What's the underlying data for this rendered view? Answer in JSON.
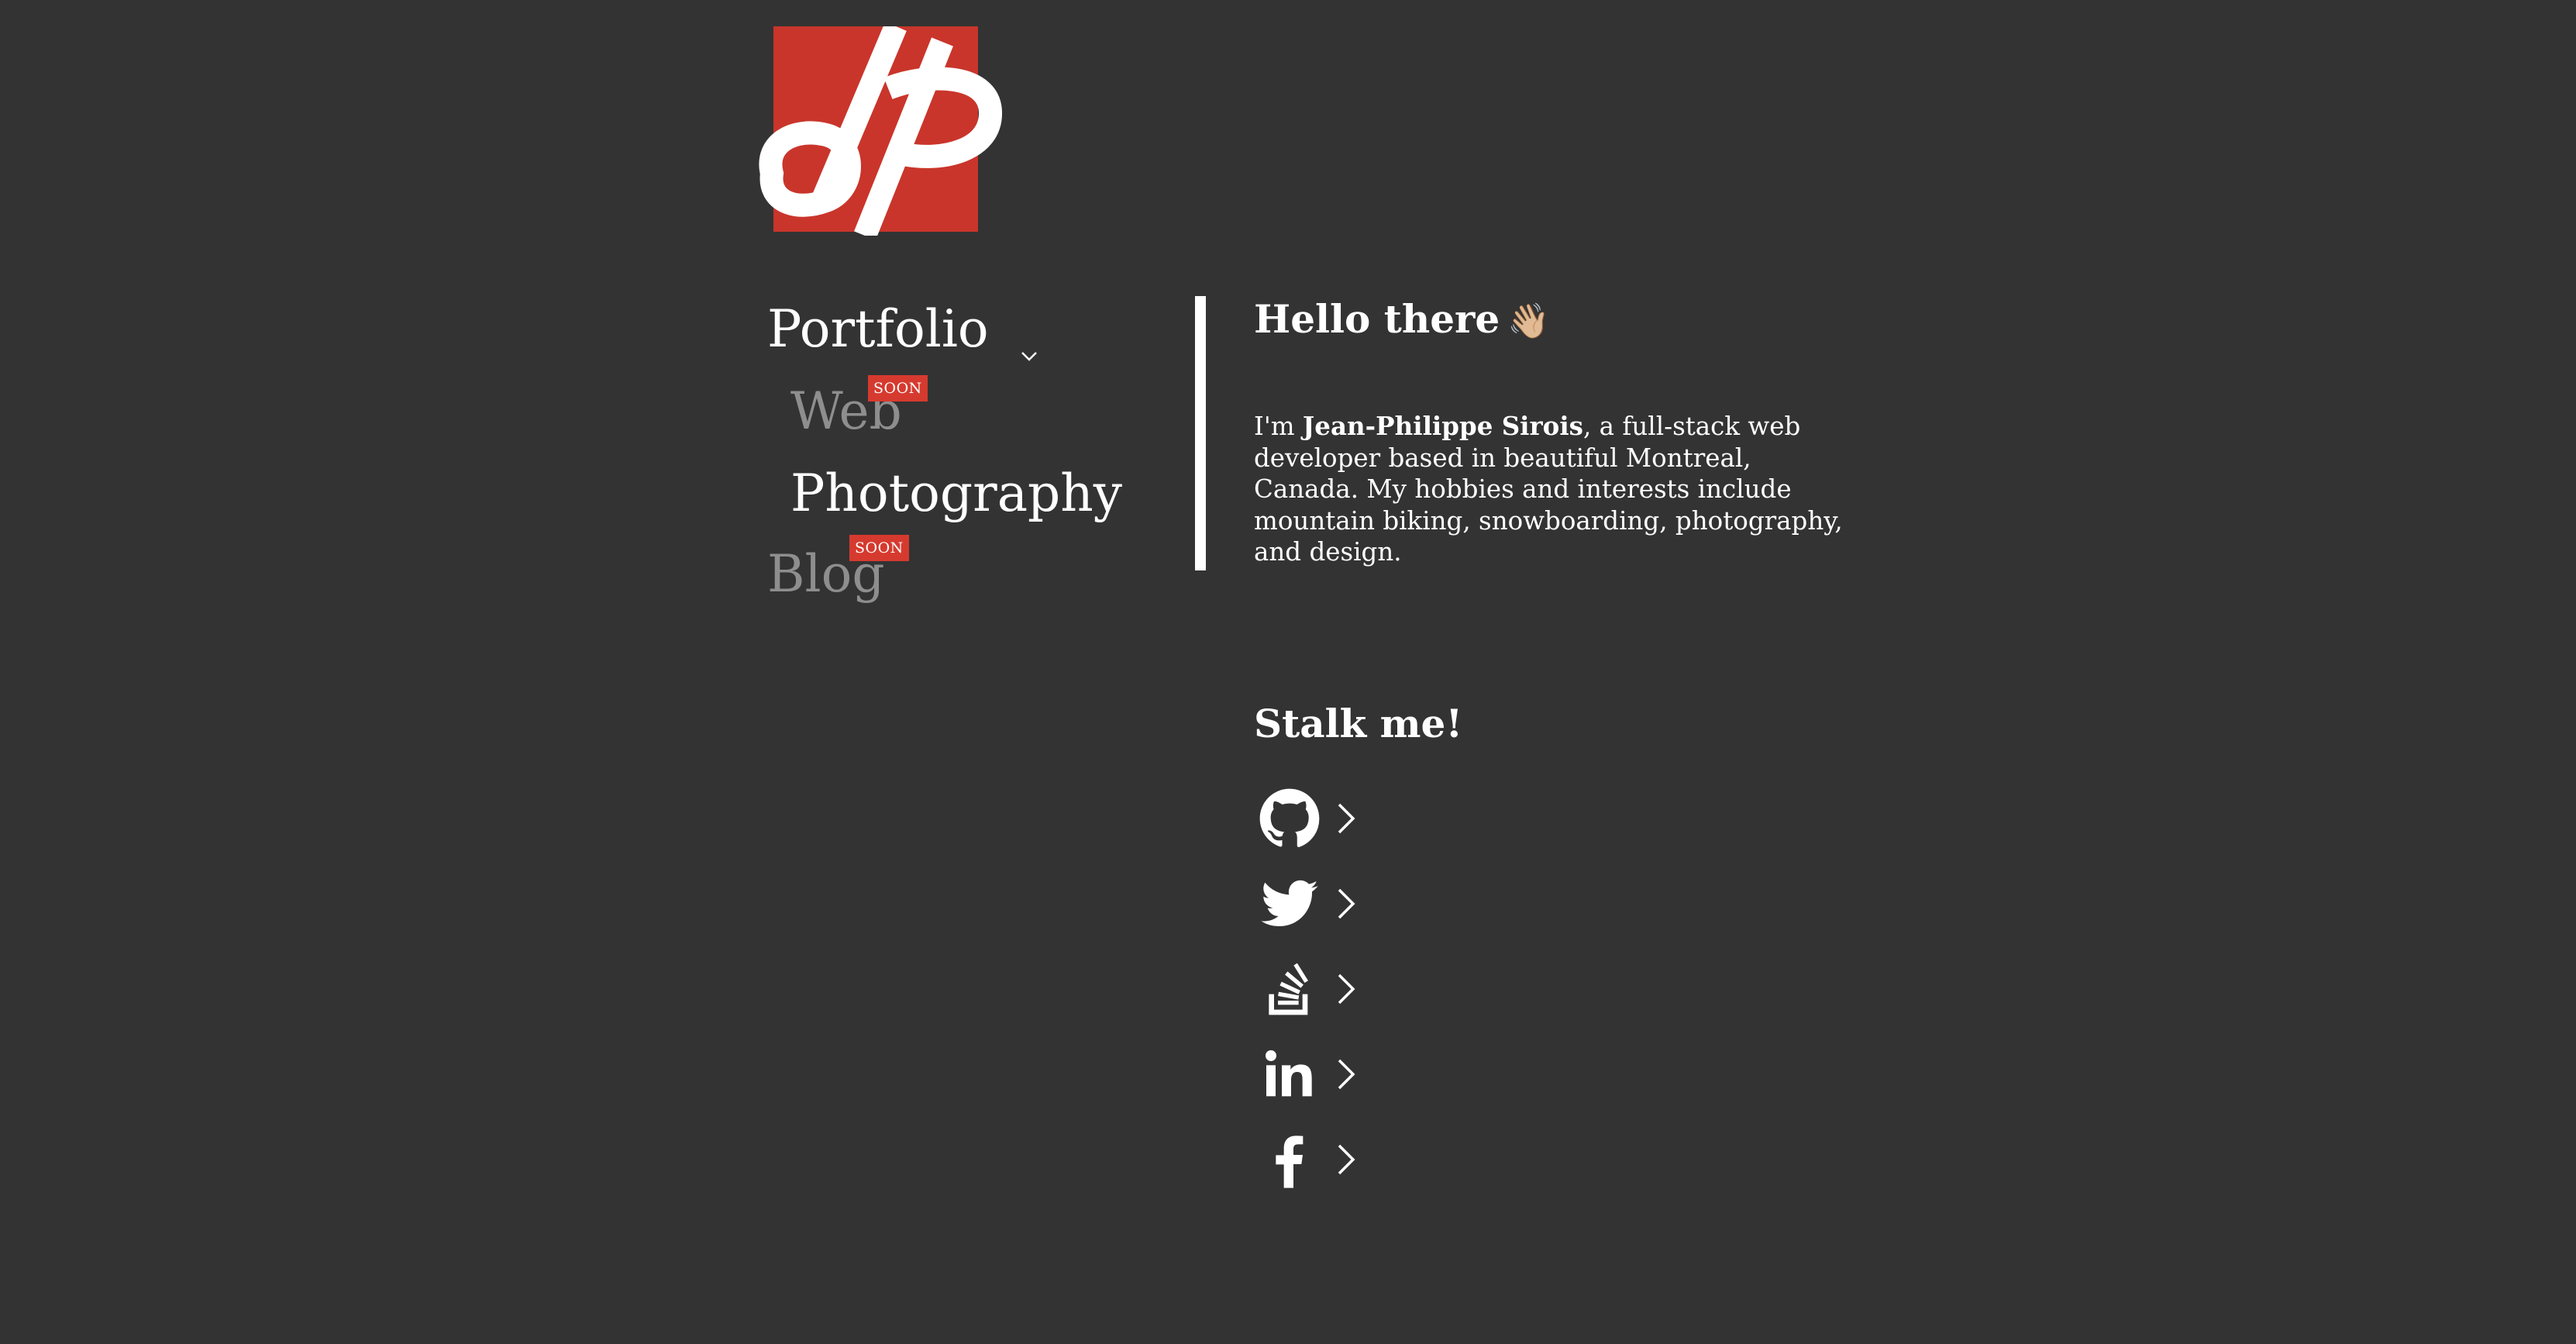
{
  "logo": {
    "name": "JP monogram logo",
    "color": "#c9352b"
  },
  "nav": {
    "portfolio_label": "Portfolio",
    "web_label": "Web",
    "web_badge": "SOON",
    "photography_label": "Photography",
    "blog_label": "Blog",
    "blog_badge": "SOON"
  },
  "main": {
    "hello_title": "Hello there",
    "hello_emoji": "👋🏼",
    "bio_prefix": "I'm ",
    "bio_name": "Jean-Philippe Sirois",
    "bio_rest": ", a full-stack web developer based in beautiful Montreal, Canada. My hobbies and interests include mountain biking, snowboarding, photography, and design.",
    "stalk_title": "Stalk me!"
  },
  "socials": [
    {
      "icon": "github-icon"
    },
    {
      "icon": "twitter-icon"
    },
    {
      "icon": "stackoverflow-icon"
    },
    {
      "icon": "linkedin-icon"
    },
    {
      "icon": "facebook-icon"
    }
  ],
  "colors": {
    "background": "#333333",
    "text": "#ffffff",
    "muted": "#8e8e8e",
    "accent": "#d63a2f"
  }
}
